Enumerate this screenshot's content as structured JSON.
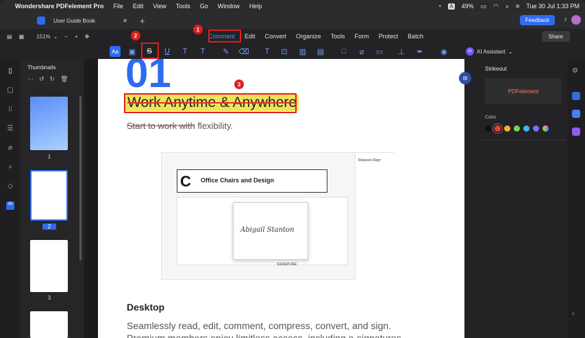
{
  "menubar": {
    "app_name": "Wondershare PDFelement Pro",
    "items": [
      "File",
      "Edit",
      "View",
      "Tools",
      "Go",
      "Window",
      "Help"
    ],
    "battery": "49%",
    "datetime": "Tue 30 Jul 1:33 PM",
    "input_badge": "A"
  },
  "tab": {
    "title": "User Guide Book",
    "close": "✕",
    "add": "+"
  },
  "feedback_label": "Feedback",
  "toolbar": {
    "zoom": "151%",
    "menu": [
      "Comment",
      "Edit",
      "Convert",
      "Organize",
      "Tools",
      "Form",
      "Protect",
      "Batch"
    ],
    "share_label": "Share"
  },
  "ai_assistant": {
    "badge": "AI",
    "label": "AI Assistant"
  },
  "thumbnails": {
    "title": "Thumbnails",
    "pages": [
      "1",
      "2",
      "3"
    ],
    "selected": "2"
  },
  "document": {
    "heading_number": "01",
    "headline": "Work Anytime & Anywhere",
    "subline_struck": "Start to work with",
    "subline_rest": " flexibility.",
    "section_title": "Desktop",
    "paragraph": "Seamlessly read, edit, comment, compress, convert, and sign. Premium members enjoy limitless access, including e-signatures."
  },
  "embedded_screenshot": {
    "title": "Office Chairs and Design",
    "letter": "C",
    "sign_panel": "Request eSign",
    "signature": "Abigail Stanton",
    "signature_label": "SIGNATURE:"
  },
  "right_panel": {
    "title": "Strikeout",
    "preview_label": "PDFelement",
    "color_label": "Color",
    "colors": [
      "#111111",
      "#e0453a",
      "#f0b431",
      "#7bd24a",
      "#3fb6f0",
      "#7b6ef6",
      "#f58ad0"
    ]
  },
  "callouts": [
    "1",
    "2",
    "3"
  ]
}
